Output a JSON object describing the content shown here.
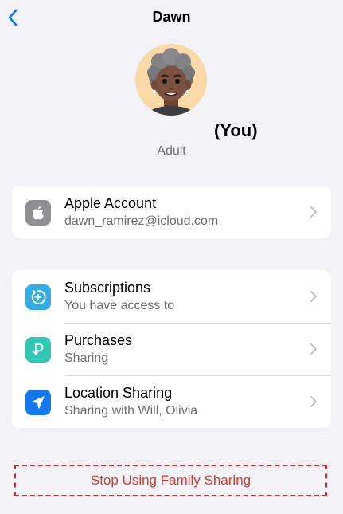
{
  "nav": {
    "title": "Dawn",
    "back_icon": "chevron-left-icon"
  },
  "profile": {
    "you_label": "(You)",
    "role": "Adult"
  },
  "account": {
    "title": "Apple Account",
    "subtitle": "dawn_ramirez@icloud.com",
    "icon": "apple-logo-icon"
  },
  "items": [
    {
      "title": "Subscriptions",
      "subtitle": "You have access to",
      "icon": "subscriptions-plus-icon",
      "color": "#32ade6"
    },
    {
      "title": "Purchases",
      "subtitle": "Sharing",
      "icon": "purchases-icon",
      "color": "#30c8b4"
    },
    {
      "title": "Location Sharing",
      "subtitle": "Sharing with Will, Olivia",
      "icon": "location-arrow-icon",
      "color": "#1478f0"
    }
  ],
  "actions": {
    "stop_label": "Stop Using Family Sharing"
  },
  "colors": {
    "accent": "#007aff",
    "destructive": "#e0362c",
    "account_icon": "#8e8e93"
  }
}
